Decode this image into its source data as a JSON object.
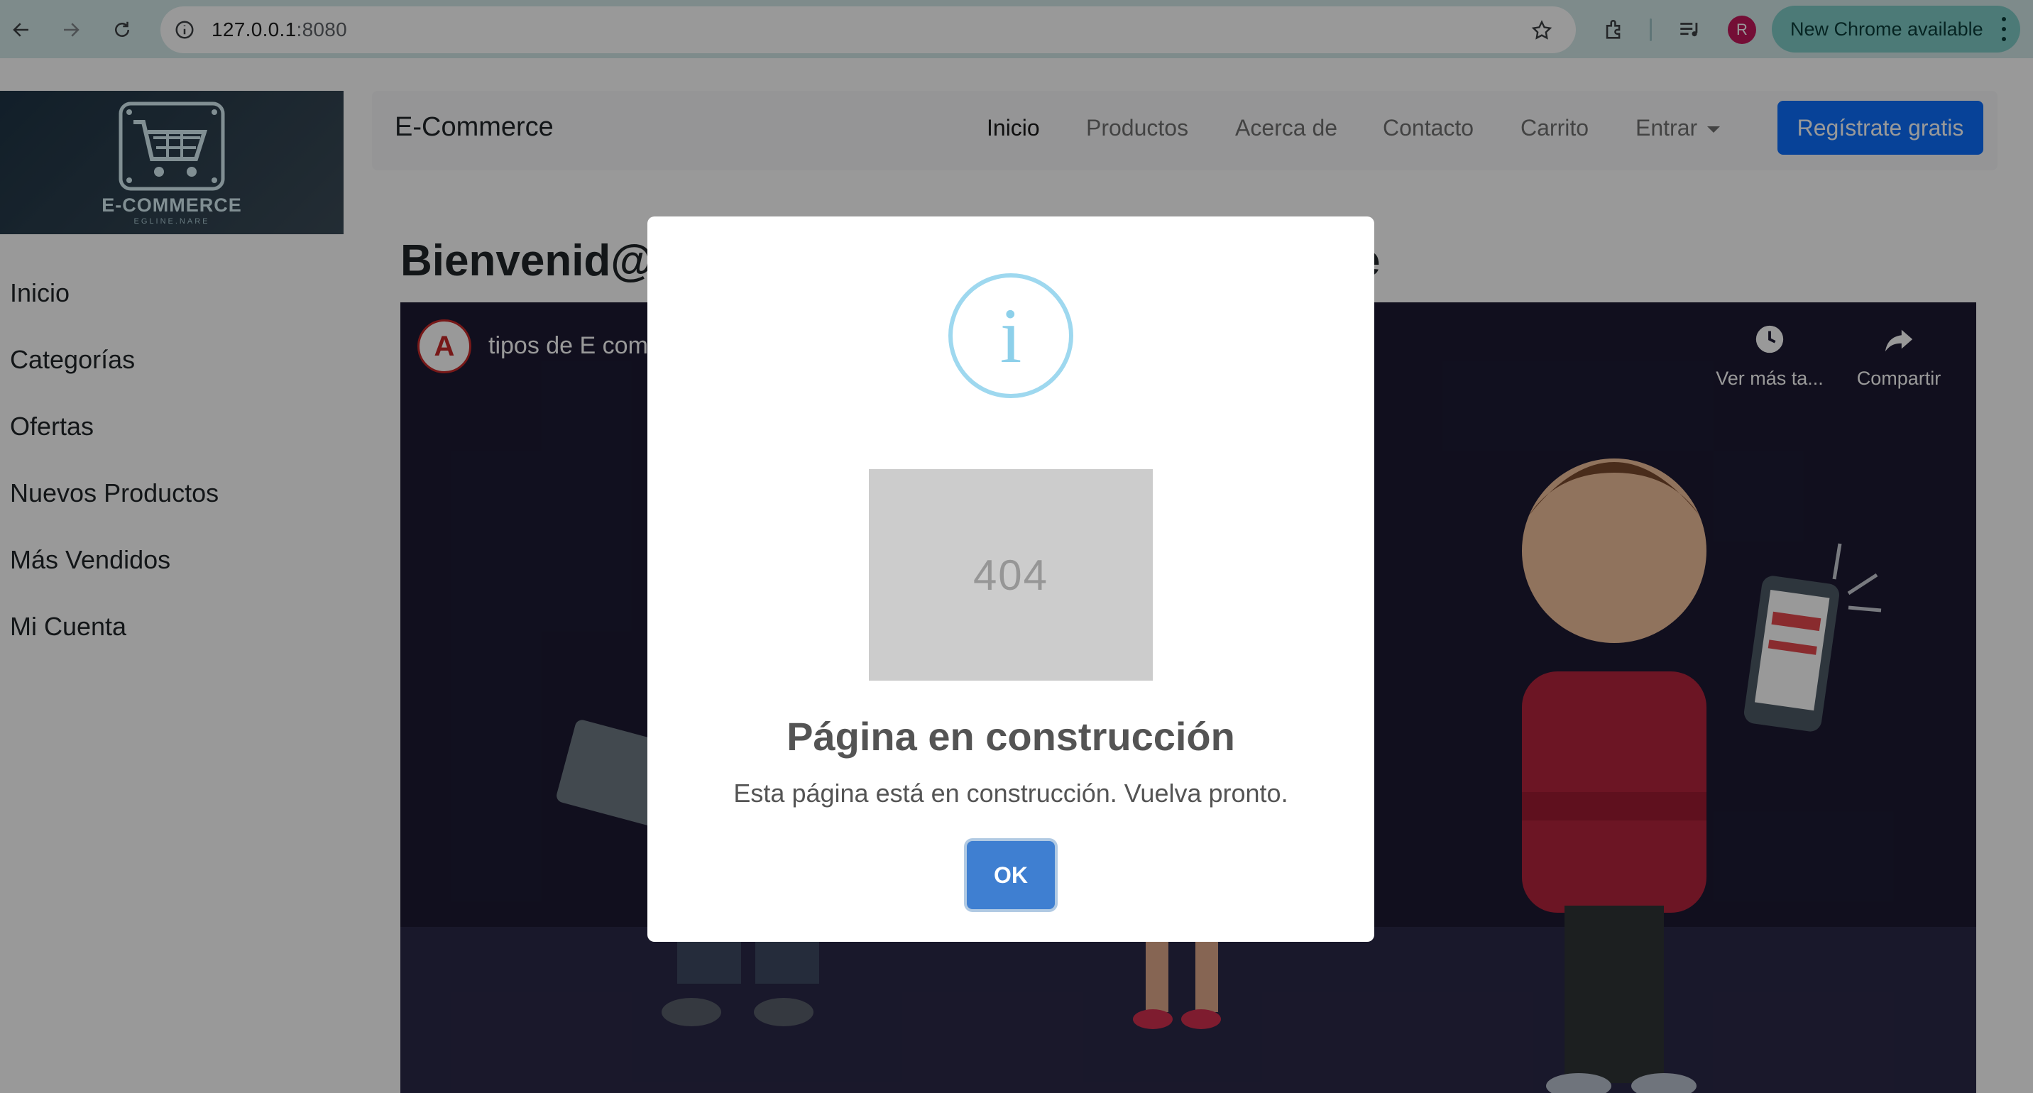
{
  "browser": {
    "url_host": "127.0.0.1",
    "url_port": ":8080",
    "profile_initial": "R",
    "update_label": "New Chrome available"
  },
  "sidebar": {
    "logo_text": "E-COMMERCE",
    "logo_subtext": "EGLINE.NARE",
    "items": [
      {
        "label": "Inicio"
      },
      {
        "label": "Categorías"
      },
      {
        "label": "Ofertas"
      },
      {
        "label": "Nuevos Productos"
      },
      {
        "label": "Más Vendidos"
      },
      {
        "label": "Mi Cuenta"
      }
    ]
  },
  "navbar": {
    "brand": "E-Commerce",
    "links": [
      {
        "label": "Inicio",
        "active": true
      },
      {
        "label": "Productos"
      },
      {
        "label": "Acerca de"
      },
      {
        "label": "Contacto"
      },
      {
        "label": "Carrito"
      },
      {
        "label": "Entrar",
        "dropdown": true
      }
    ],
    "register_label": "Regístrate gratis"
  },
  "main": {
    "heading_visible_start": "Bienvenid@",
    "heading_visible_end": "e"
  },
  "video": {
    "channel_initial": "A",
    "title_visible": "tipos de E com",
    "watch_later_label": "Ver más ta...",
    "share_label": "Compartir"
  },
  "modal": {
    "icon": "info-icon",
    "image_text": "404",
    "title": "Página en construcción",
    "text": "Esta página está en construcción. Vuelva pronto.",
    "ok_label": "OK"
  },
  "colors": {
    "chrome_bg": "#d3e8e8",
    "primary": "#0d6efd",
    "ok_button": "#3f7fd1",
    "info_icon": "#9ed8ef",
    "video_bg": "#1d1a33"
  }
}
